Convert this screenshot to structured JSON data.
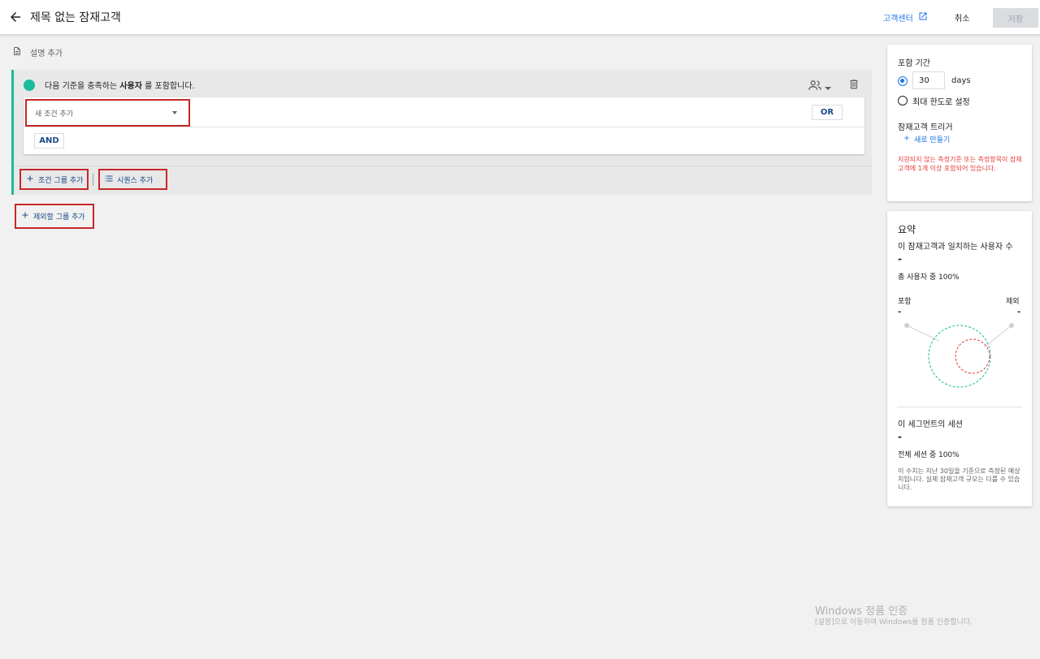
{
  "header": {
    "title": "제목 없는 잠재고객",
    "help_label": "고객센터",
    "cancel_label": "취소",
    "save_label": "저장"
  },
  "description": {
    "add_label": "설명 추가"
  },
  "include": {
    "prefix": "다음 기준을 충족하는",
    "subject": "사용자",
    "suffix": "를 포함합니다.",
    "new_condition_placeholder": "새 조건 추가",
    "or_label": "OR",
    "and_label": "AND",
    "add_group_label": "조건 그룹 추가",
    "add_sequence_label": "시퀀스 추가"
  },
  "exclude": {
    "add_label": "제외할 그룹 추가"
  },
  "membership": {
    "title": "포함 기간",
    "days_value": "30",
    "days_unit": "days",
    "max_label": "최대 한도로 설정",
    "trigger_title": "잠재고객 트리거",
    "new_label": "새로 만들기",
    "warning": "지원되지 않는 측정기준 또는 측정항목이 잠재고객에 1개 이상 포함되어 있습니다."
  },
  "summary": {
    "title": "요약",
    "users_label": "이 잠재고객과 일치하는 사용자 수",
    "users_value": "-",
    "users_pct": "총 사용자 중 100%",
    "include_label": "포함",
    "include_value": "-",
    "exclude_label": "제외",
    "exclude_value": "-",
    "sessions_label": "이 세그먼트의 세션",
    "sessions_value": "-",
    "sessions_pct": "전체 세션 중 100%",
    "note": "이 수치는 지난 30일을 기준으로 측정된 예상치입니다. 실제 잠재고객 규모는 다를 수 있습니다."
  },
  "watermark": {
    "line1": "Windows 정품 인증",
    "line2": "[설정]으로 이동하여 Windows를 정품 인증합니다."
  },
  "colors": {
    "accent": "#1abc9c",
    "link": "#1a73e8",
    "warning": "#e53935",
    "highlight": "#c62828"
  }
}
